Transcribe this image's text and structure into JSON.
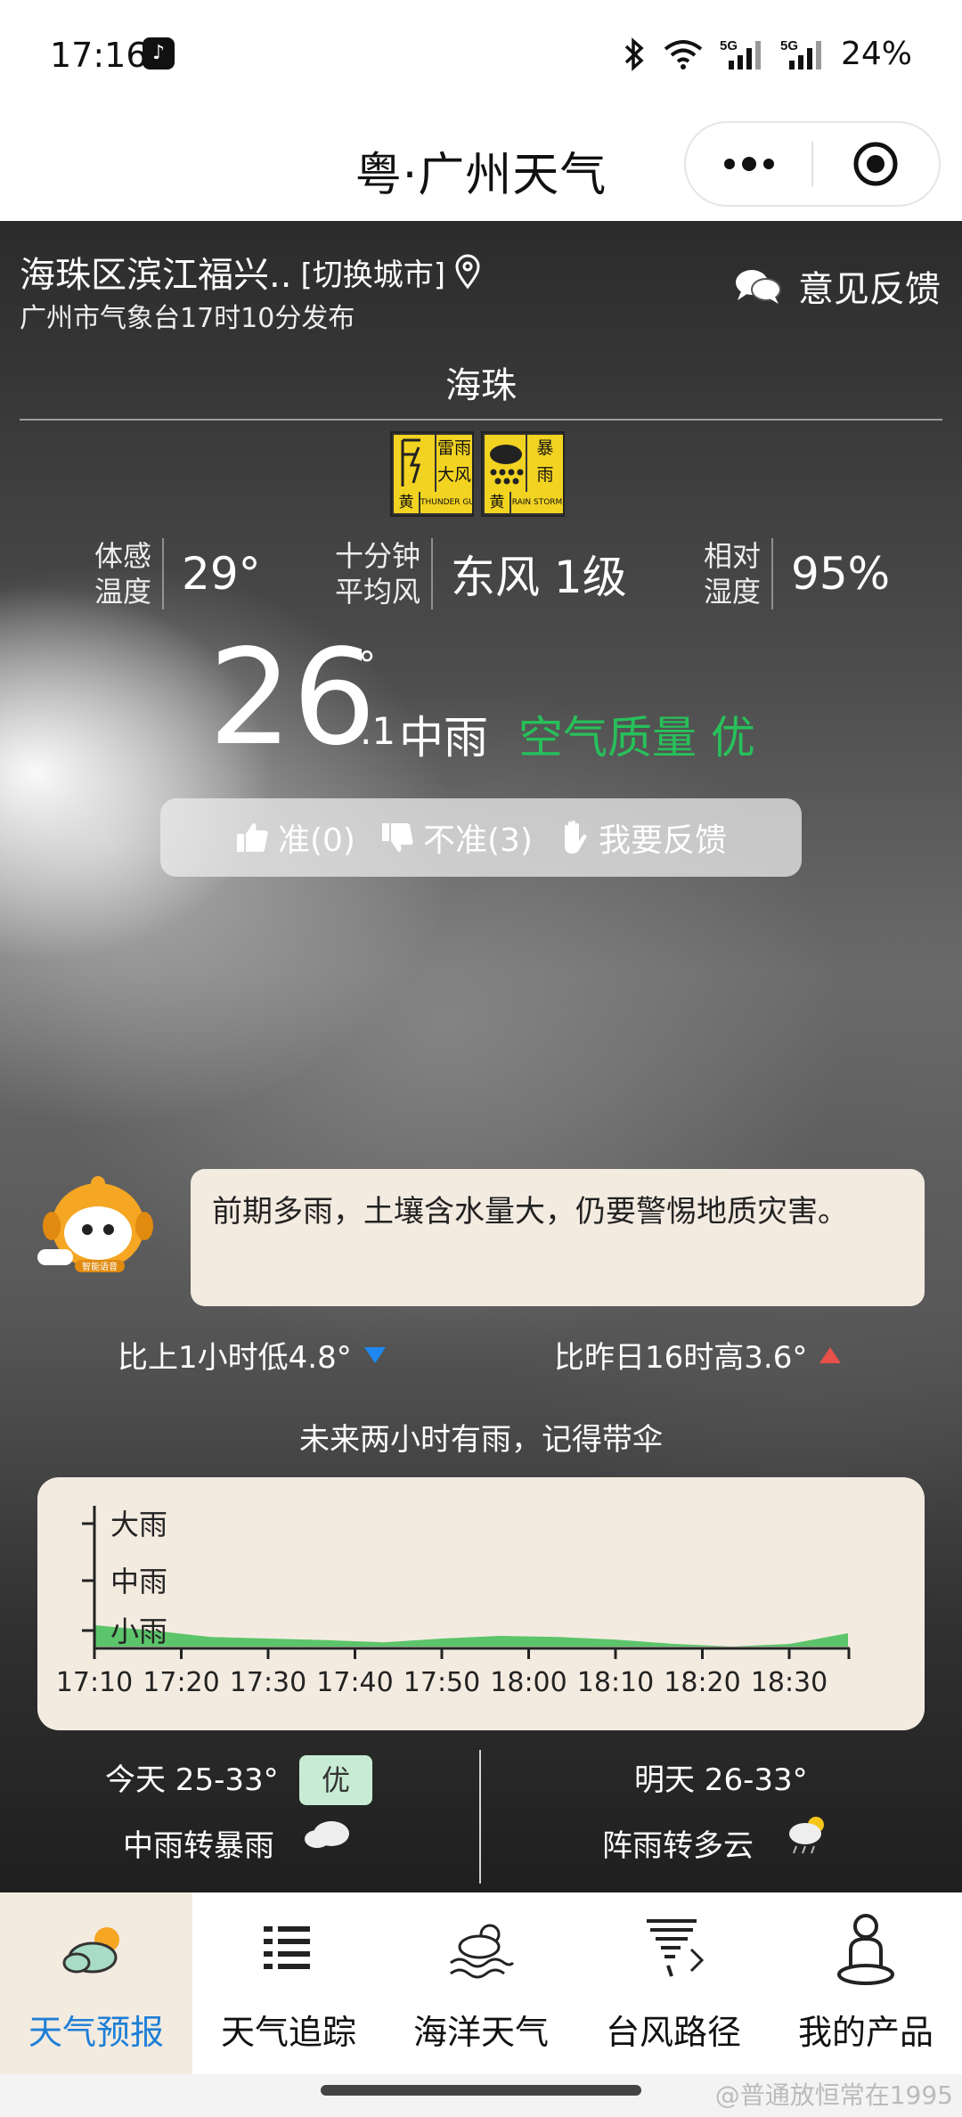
{
  "status_bar": {
    "time": "17:16",
    "battery": "24%",
    "net1": "5G",
    "net2": "5G"
  },
  "titlebar": {
    "title": "粤·广州天气"
  },
  "location": {
    "name": "海珠区滨江福兴..",
    "switch_label": "[切换城市]",
    "published": "广州市气象台17时10分发布",
    "feedback": "意见反馈",
    "district": "海珠"
  },
  "alerts": [
    {
      "text1": "雷雨",
      "text2": "大风",
      "level": "黄",
      "en": "THUNDER GUST"
    },
    {
      "text1": "暴",
      "text2": "雨",
      "level": "黄",
      "en": "RAIN STORM"
    }
  ],
  "stats": {
    "feel_label1": "体感",
    "feel_label2": "温度",
    "feel_value": "29°",
    "wind_label1": "十分钟",
    "wind_label2": "平均风",
    "wind_value": "东风 1级",
    "hum_label1": "相对",
    "hum_label2": "湿度",
    "hum_value": "95%"
  },
  "current": {
    "temp": "26",
    "deg": "°",
    "decimal": ".1",
    "condition": "中雨",
    "aqi": "空气质量 优"
  },
  "feedback_bar": {
    "accurate": "准(0)",
    "inaccurate": "不准(3)",
    "report": "我要反馈"
  },
  "tip": {
    "text": "前期多雨，土壤含水量大，仍要警惕地质灾害。",
    "mascot_label": "智能语音"
  },
  "compare": {
    "hour": "比上1小时低4.8°",
    "yesterday": "比昨日16时高3.6°"
  },
  "rain_tip": "未来两小时有雨，记得带伞",
  "chart_data": {
    "type": "area",
    "title": "",
    "x": [
      "17:10",
      "17:20",
      "17:30",
      "17:40",
      "17:50",
      "18:00",
      "18:10",
      "18:20",
      "18:30"
    ],
    "y_levels": [
      "小雨",
      "中雨",
      "大雨"
    ],
    "series": [
      {
        "values": [
          0.4,
          0.3,
          0.18,
          0.15,
          0.12,
          0.08,
          0.15,
          0.2,
          0.18,
          0.13,
          0.05,
          0.0,
          0.05,
          0.25
        ]
      }
    ],
    "ylim": [
      0,
      3
    ],
    "colors": {
      "fill": "#5cc46a"
    }
  },
  "forecast": {
    "today_label": "今天 25-33°",
    "today_badge": "优",
    "today_cond": "中雨转暴雨",
    "tomorrow_label": "明天 26-33°",
    "tomorrow_cond": "阵雨转多云"
  },
  "tabs": [
    {
      "label": "天气预报",
      "icon": "weather-forecast-icon"
    },
    {
      "label": "天气追踪",
      "icon": "weather-tracking-icon"
    },
    {
      "label": "海洋天气",
      "icon": "marine-weather-icon"
    },
    {
      "label": "台风路径",
      "icon": "typhoon-path-icon"
    },
    {
      "label": "我的产品",
      "icon": "my-products-icon"
    }
  ],
  "watermark": "@普通放恒常在1995"
}
